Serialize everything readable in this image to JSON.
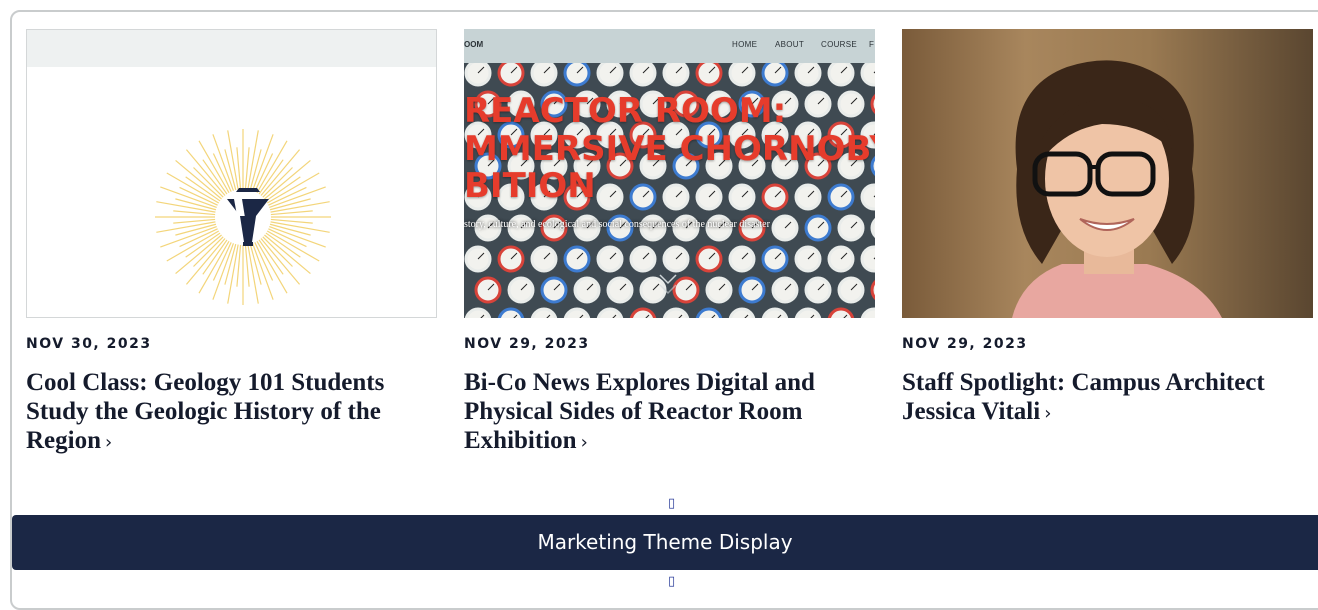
{
  "cards": [
    {
      "date": "NOV 30, 2023",
      "title": "Cool Class: Geology 101 Students Study the Geologic History of the Region",
      "icon": "lamp-icon"
    },
    {
      "date": "NOV 29, 2023",
      "title": "Bi-Co News Explores Digital and Physical Sides of Reactor Room Exhibition",
      "thumb": {
        "brand": "OOM",
        "nav": [
          "HOME",
          "ABOUT",
          "COURSE",
          "F"
        ],
        "heading_lines": [
          "REACTOR ROOM:",
          "MMERSIVE CHORNOBYL",
          "BITION"
        ],
        "subtitle": "story, culture, and ecological and social consequences of the nuclear disaster"
      }
    },
    {
      "date": "NOV 29, 2023",
      "title": "Staff Spotlight: Campus Architect Jessica Vitali"
    }
  ],
  "chevron": "›",
  "placeholder_glyph": "▯",
  "footer_bar": {
    "label": "Marketing Theme Display"
  },
  "colors": {
    "navy": "#1b2745",
    "text": "#151b2c",
    "reactor_red": "#e63c2c",
    "lamp_gold": "#f3d57a"
  }
}
